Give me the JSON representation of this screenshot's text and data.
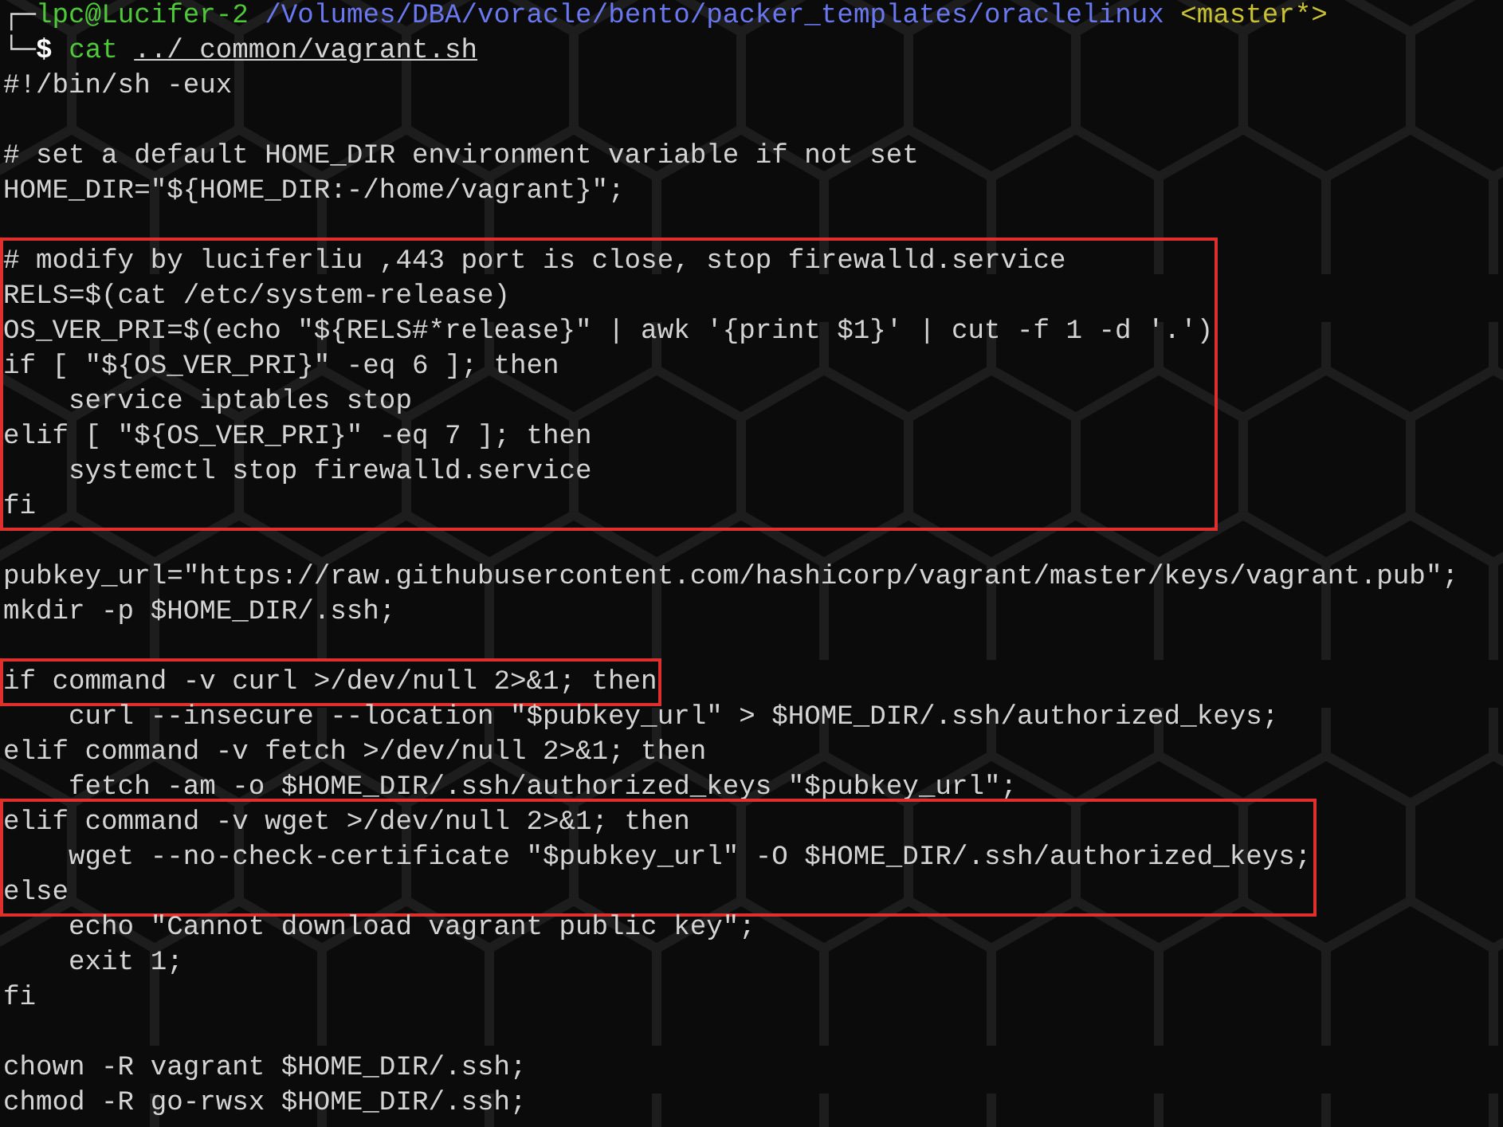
{
  "prompt": {
    "corner": "┌─",
    "user": "lpc@Lucifer-2",
    "path": "/Volumes/DBA/voracle/bento/packer_templates/oraclelinux",
    "branch": "<master*>"
  },
  "command": {
    "corner": "└─",
    "symbol": "$",
    "program": "cat",
    "argument": "../_common/vagrant.sh"
  },
  "blocks": [
    {
      "highlighted": false,
      "lines": [
        {
          "kind": "code",
          "text": "#!/bin/sh -eux"
        },
        {
          "kind": "blank"
        },
        {
          "kind": "code",
          "text": "# set a default HOME_DIR environment variable if not set"
        },
        {
          "kind": "code",
          "text": "HOME_DIR=\"${HOME_DIR:-/home/vagrant}\";"
        },
        {
          "kind": "blank"
        }
      ]
    },
    {
      "highlighted": true,
      "lines": [
        {
          "kind": "code",
          "text": "# modify by luciferliu ,443 port is close, stop firewalld.service"
        },
        {
          "kind": "code",
          "text": "RELS=$(cat /etc/system-release)"
        },
        {
          "kind": "code",
          "text": "OS_VER_PRI=$(echo \"${RELS#*release}\" | awk '{print $1}' | cut -f 1 -d '.')"
        },
        {
          "kind": "code",
          "text": "if [ \"${OS_VER_PRI}\" -eq 6 ]; then"
        },
        {
          "kind": "code",
          "text": "    service iptables stop"
        },
        {
          "kind": "code",
          "text": "elif [ \"${OS_VER_PRI}\" -eq 7 ]; then"
        },
        {
          "kind": "code",
          "text": "    systemctl stop firewalld.service"
        },
        {
          "kind": "code",
          "text": "fi"
        }
      ]
    },
    {
      "highlighted": false,
      "lines": [
        {
          "kind": "blank"
        },
        {
          "kind": "code",
          "text": "pubkey_url=\"https://raw.githubusercontent.com/hashicorp/vagrant/master/keys/vagrant.pub\";"
        },
        {
          "kind": "code",
          "text": "mkdir -p $HOME_DIR/.ssh;"
        },
        {
          "kind": "blank"
        }
      ]
    },
    {
      "highlighted": true,
      "lines": [
        {
          "kind": "code",
          "text": "if command -v curl >/dev/null 2>&1; then"
        }
      ]
    },
    {
      "highlighted": false,
      "lines": [
        {
          "kind": "code",
          "text": "    curl --insecure --location \"$pubkey_url\" > $HOME_DIR/.ssh/authorized_keys;"
        },
        {
          "kind": "code",
          "text": "elif command -v fetch >/dev/null 2>&1; then"
        },
        {
          "kind": "code",
          "text": "    fetch -am -o $HOME_DIR/.ssh/authorized_keys \"$pubkey_url\";"
        }
      ]
    },
    {
      "highlighted": true,
      "lines": [
        {
          "kind": "code",
          "text": "elif command -v wget >/dev/null 2>&1; then"
        },
        {
          "kind": "code",
          "text": "    wget --no-check-certificate \"$pubkey_url\" -O $HOME_DIR/.ssh/authorized_keys;"
        },
        {
          "kind": "code",
          "text": "else"
        }
      ]
    },
    {
      "highlighted": false,
      "lines": [
        {
          "kind": "code",
          "text": "    echo \"Cannot download vagrant public key\";"
        },
        {
          "kind": "code",
          "text": "    exit 1;"
        },
        {
          "kind": "code",
          "text": "fi"
        },
        {
          "kind": "blank"
        },
        {
          "kind": "code",
          "text": "chown -R vagrant $HOME_DIR/.ssh;"
        },
        {
          "kind": "code",
          "text": "chmod -R go-rwsx $HOME_DIR/.ssh;"
        }
      ]
    }
  ]
}
